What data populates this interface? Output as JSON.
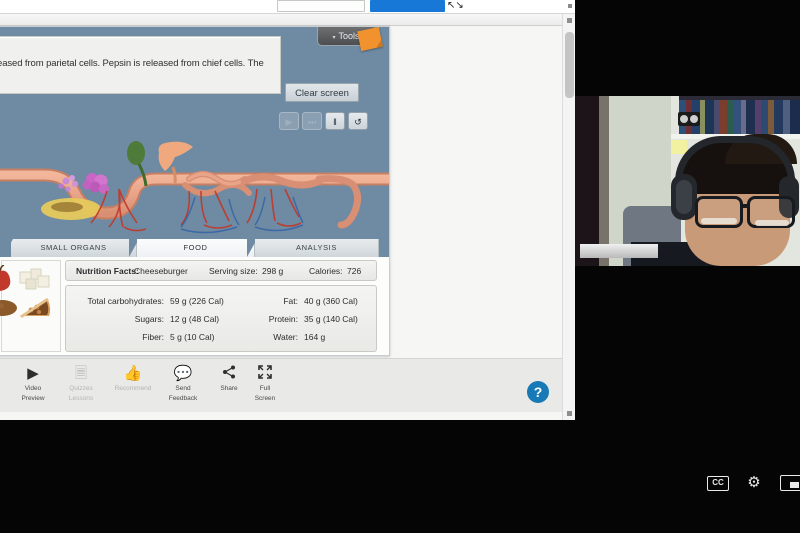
{
  "browser": {
    "url_value": "",
    "url_placeholder": "",
    "go_button_label": "",
    "collapse_icon": "collapse-arrows-icon"
  },
  "simulation": {
    "readout_text": "leased from parietal cells. Pepsin is released from chief cells. The",
    "tools_button": {
      "label": "Tools",
      "chevron": "▾",
      "note_icon": "sticky-note-icon"
    },
    "clear_screen_label": "Clear screen",
    "playback": [
      {
        "name": "play",
        "glyph": "▶",
        "state": "disabled"
      },
      {
        "name": "step-forward",
        "glyph": "⏭",
        "state": "disabled"
      },
      {
        "name": "pause",
        "glyph": "‖",
        "state": "enabled"
      },
      {
        "name": "reset",
        "glyph": "↺",
        "state": "enabled"
      }
    ],
    "tabs": [
      {
        "label": "SMALL ORGANS",
        "active": false
      },
      {
        "label": "FOOD",
        "active": true
      },
      {
        "label": "ANALYSIS",
        "active": false
      }
    ],
    "food_thumbnails": [
      {
        "name": "apple-thumbnail"
      },
      {
        "name": "cheese-cubes-thumbnail"
      },
      {
        "name": "potato-thumbnail"
      },
      {
        "name": "pecan-pie-thumbnail"
      }
    ],
    "nutrition": {
      "header": {
        "title": "Nutrition Facts:",
        "food": "Cheeseburger",
        "serving_label": "Serving size:",
        "serving_value": "298 g",
        "calories_label": "Calories:",
        "calories_value": "726"
      },
      "left_rows": [
        {
          "label": "Total carbohydrates:",
          "value": "59 g (226 Cal)"
        },
        {
          "label": "Sugars:",
          "value": "12 g (48 Cal)"
        },
        {
          "label": "Fiber:",
          "value": "5 g (10 Cal)"
        }
      ],
      "right_rows": [
        {
          "label": "Fat:",
          "value": "40 g (360 Cal)"
        },
        {
          "label": "Protein:",
          "value": "35 g (140 Cal)"
        },
        {
          "label": "Water:",
          "value": "164 g"
        }
      ]
    }
  },
  "gizmo_toolbar": {
    "items": [
      {
        "icon": "play-triangle-icon",
        "glyph": "▶",
        "label_line1": "Video",
        "label_line2": "Preview",
        "dim": false
      },
      {
        "icon": "quiz-page-icon",
        "glyph": "὜E",
        "label_line1": "Quizzes",
        "label_line2": "Lessons",
        "dim": true
      },
      {
        "icon": "thumbs-up-icon",
        "glyph": "👍",
        "label_line1": "Recommend",
        "label_line2": "",
        "dim": true
      },
      {
        "icon": "speech-bubble-icon",
        "glyph": "💬",
        "label_line1": "Send",
        "label_line2": "Feedback",
        "dim": false
      },
      {
        "icon": "share-nodes-icon",
        "glyph": "➦",
        "label_line1": "Share",
        "label_line2": "",
        "dim": false
      },
      {
        "icon": "expand-arrows-icon",
        "glyph": "⤢",
        "label_line1": "Full",
        "label_line2": "Screen",
        "dim": false
      }
    ],
    "help_button_label": "?"
  },
  "webcam": {
    "participant_label": ""
  },
  "player_controls": [
    {
      "name": "closed-captions",
      "label": "CC"
    },
    {
      "name": "settings-gear",
      "glyph": "⚙"
    },
    {
      "name": "picture-in-picture",
      "label": ""
    }
  ],
  "colors": {
    "sim_canvas": "#6f8ba3",
    "accent_blue": "#1779b5",
    "sticky_orange": "#f2922e",
    "url_button_blue": "#1878d8"
  }
}
